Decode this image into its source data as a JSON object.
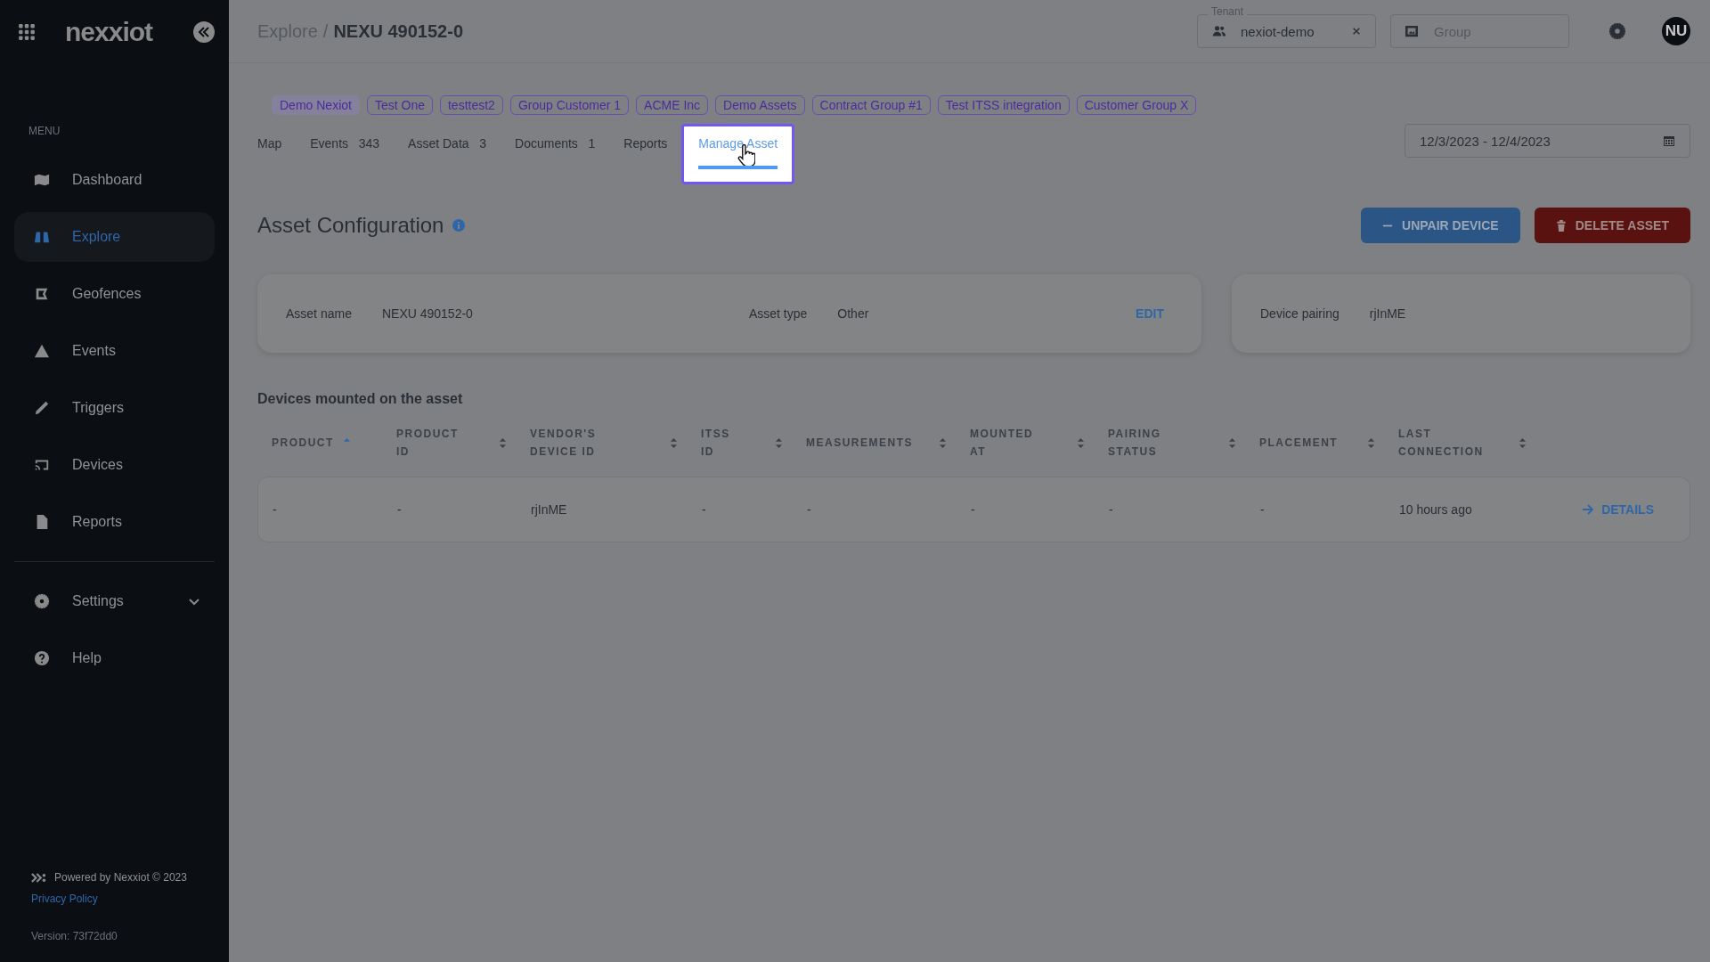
{
  "sidebar": {
    "logo": "nexxiot",
    "menu_label": "MENU",
    "items": [
      {
        "label": "Dashboard",
        "selected": false
      },
      {
        "label": "Explore",
        "selected": true
      },
      {
        "label": "Geofences",
        "selected": false
      },
      {
        "label": "Events",
        "selected": false
      },
      {
        "label": "Triggers",
        "selected": false
      },
      {
        "label": "Devices",
        "selected": false
      },
      {
        "label": "Reports",
        "selected": false
      }
    ],
    "bottom_items": [
      {
        "label": "Settings",
        "expandable": true
      },
      {
        "label": "Help",
        "expandable": false
      }
    ],
    "powered_by": "Powered by Nexxiot © 2023",
    "privacy_link": "Privacy Policy",
    "version": "Version: 73f72dd0"
  },
  "header": {
    "breadcrumb_parent": "Explore",
    "breadcrumb_separator": "/",
    "breadcrumb_current": "NEXU 490152-0",
    "tenant": {
      "label": "Tenant",
      "value": "nexiot-demo"
    },
    "group": {
      "placeholder": "Group"
    },
    "avatar": "NU"
  },
  "tags": [
    {
      "label": "Demo Nexiot",
      "selected": true
    },
    {
      "label": "Test One",
      "selected": false
    },
    {
      "label": "testtest2",
      "selected": false
    },
    {
      "label": "Group Customer 1",
      "selected": false
    },
    {
      "label": "ACME Inc",
      "selected": false
    },
    {
      "label": "Demo Assets",
      "selected": false
    },
    {
      "label": "Contract Group #1",
      "selected": false
    },
    {
      "label": "Test ITSS integration",
      "selected": false
    },
    {
      "label": "Customer Group X",
      "selected": false
    }
  ],
  "tabs": [
    {
      "label": "Map",
      "selected": false
    },
    {
      "label": "Events",
      "count": "343",
      "selected": false
    },
    {
      "label": "Asset Data",
      "count": "3",
      "selected": false
    },
    {
      "label": "Documents",
      "count": "1",
      "selected": false
    },
    {
      "label": "Reports",
      "selected": false
    },
    {
      "label": "Manage Asset",
      "selected": true
    }
  ],
  "date_range": "12/3/2023 - 12/4/2023",
  "section": {
    "title": "Asset Configuration",
    "unpair_button": "UNPAIR DEVICE",
    "delete_button": "DELETE ASSET"
  },
  "asset_card": {
    "name_label": "Asset name",
    "name": "NEXU 490152-0",
    "type_label": "Asset type",
    "type": "Other",
    "edit": "EDIT"
  },
  "pairing_card": {
    "label": "Device pairing",
    "value": "rjInME"
  },
  "devices_table": {
    "title": "Devices mounted on the asset",
    "columns": [
      {
        "label": "PRODUCT",
        "sorted": true
      },
      {
        "label": "PRODUCT ID",
        "sorted": false
      },
      {
        "label": "VENDOR'S DEVICE ID",
        "sorted": false
      },
      {
        "label": "ITSS ID",
        "sorted": false
      },
      {
        "label": "MEASUREMENTS",
        "sorted": false
      },
      {
        "label": "MOUNTED AT",
        "sorted": false
      },
      {
        "label": "PAIRING STATUS",
        "sorted": false
      },
      {
        "label": "PLACEMENT",
        "sorted": false
      },
      {
        "label": "LAST CONNECTION",
        "sorted": false
      }
    ],
    "rows": [
      {
        "cells": [
          "-",
          "-",
          "rjInME",
          "-",
          "-",
          "-",
          "-",
          "-",
          "10 hours ago"
        ],
        "action": "DETAILS"
      }
    ]
  }
}
